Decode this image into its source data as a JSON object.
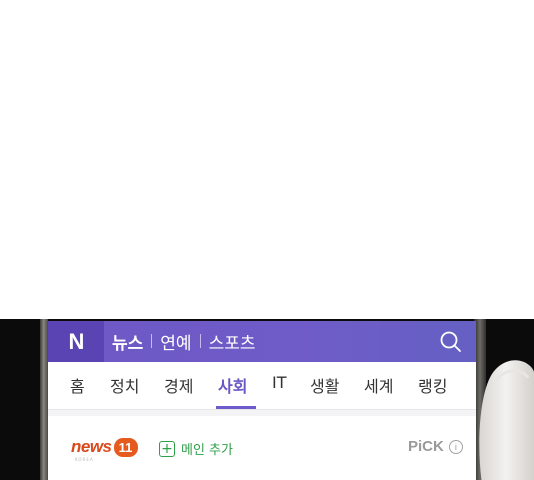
{
  "header": {
    "logo": "N",
    "sections": [
      "뉴스",
      "연예",
      "스포츠"
    ],
    "active_section": "뉴스"
  },
  "tabs": [
    {
      "label": "홈",
      "active": false
    },
    {
      "label": "정치",
      "active": false
    },
    {
      "label": "경제",
      "active": false
    },
    {
      "label": "사회",
      "active": true
    },
    {
      "label": "IT",
      "active": false
    },
    {
      "label": "생활",
      "active": false
    },
    {
      "label": "세계",
      "active": false
    },
    {
      "label": "랭킹",
      "active": false
    }
  ],
  "press": {
    "name_word": "news",
    "name_number": "11",
    "sub_label": "KOREA",
    "add_main_label": "메인 추가",
    "pick_label": "PiCK",
    "info_glyph": "i"
  },
  "colors": {
    "header_bg": "#6e58c6",
    "active_tab": "#6b57c4",
    "press_orange": "#e55a1e",
    "add_green": "#2fa04a"
  },
  "icons": {
    "search": "search-icon",
    "plus": "plus-icon",
    "info": "info-icon"
  }
}
